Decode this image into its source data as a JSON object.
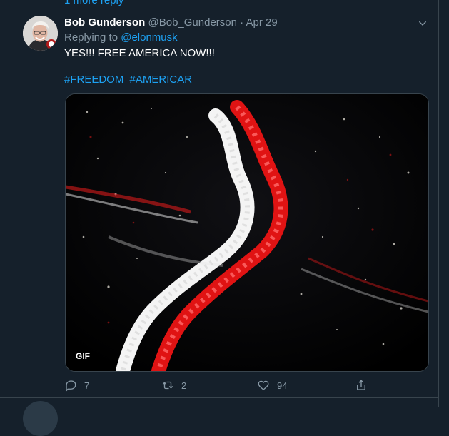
{
  "thread": {
    "more_replies_label": "1 more reply"
  },
  "tweet": {
    "author_name": "Bob Gunderson",
    "author_handle": "@Bob_Gunderson",
    "separator": "·",
    "date": "Apr 29",
    "replying_prefix": "Replying to",
    "replying_to": "@elonmusk",
    "text": "YES!!! FREE AMERICA NOW!!!",
    "hashtags": [
      "#FREEDOM",
      "#AMERICAR"
    ],
    "media": {
      "badge": "GIF"
    },
    "actions": {
      "reply_count": "7",
      "retweet_count": "2",
      "like_count": "94"
    },
    "icons": {
      "more": "chevron-down-icon",
      "reply": "reply-icon",
      "retweet": "retweet-icon",
      "like": "heart-icon",
      "share": "share-icon"
    }
  },
  "colors": {
    "background": "#15202b",
    "border": "#38444d",
    "secondary_text": "#8899a6",
    "link": "#1da1f2"
  }
}
